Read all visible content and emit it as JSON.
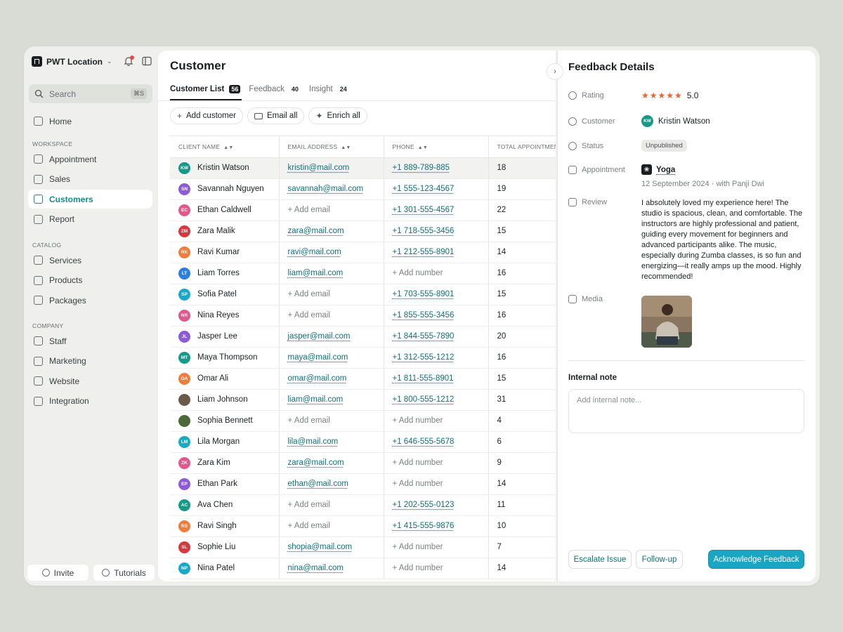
{
  "sidebar": {
    "location": "PWT Location",
    "search_placeholder": "Search",
    "search_shortcut": "⌘S",
    "home": "Home",
    "workspace_label": "WORKSPACE",
    "workspace": [
      "Appointment",
      "Sales",
      "Customers",
      "Report"
    ],
    "catalog_label": "CATALOG",
    "catalog": [
      "Services",
      "Products",
      "Packages"
    ],
    "company_label": "COMPANY",
    "company": [
      "Staff",
      "Marketing",
      "Website",
      "Integration"
    ],
    "invite": "Invite",
    "tutorials": "Tutorials"
  },
  "main": {
    "title": "Customer",
    "tabs": [
      {
        "label": "Customer List",
        "count": "56"
      },
      {
        "label": "Feedback",
        "count": "40"
      },
      {
        "label": "Insight",
        "count": "24"
      }
    ],
    "actions": {
      "add": "Add customer",
      "email": "Email all",
      "enrich": "Enrich all"
    },
    "columns": [
      "CLIENT NAME",
      "EMAIL ADDRESS",
      "PHONE",
      "TOTAL APPOINTMENTS"
    ],
    "rows": [
      {
        "initials": "KW",
        "color": "#159a8a",
        "name": "Kristin Watson",
        "email": "kristin@mail.com",
        "phone": "+1 889-789-885",
        "total": "18"
      },
      {
        "initials": "SN",
        "color": "#8e5bd6",
        "name": "Savannah Nguyen",
        "email": "savannah@mail.com",
        "phone": "+1 555-123-4567",
        "total": "19"
      },
      {
        "initials": "EC",
        "color": "#e2588a",
        "name": "Ethan Caldwell",
        "email": "+ Add email",
        "phone": "+1 301-555-4567",
        "total": "22"
      },
      {
        "initials": "ZM",
        "color": "#d9373f",
        "name": "Zara Malik",
        "email": "zara@mail.com",
        "phone": "+1 718-555-3456",
        "total": "15"
      },
      {
        "initials": "RK",
        "color": "#ef7d3c",
        "name": "Ravi Kumar",
        "email": "ravi@mail.com",
        "phone": "+1 212-555-8901",
        "total": "14"
      },
      {
        "initials": "LT",
        "color": "#2b7fe0",
        "name": "Liam Torres",
        "email": "liam@mail.com",
        "phone": "+ Add number",
        "total": "16"
      },
      {
        "initials": "SP",
        "color": "#17a9c7",
        "name": "Sofia Patel",
        "email": "+ Add email",
        "phone": "+1 703-555-8901",
        "total": "15"
      },
      {
        "initials": "NR",
        "color": "#e2588a",
        "name": "Nina Reyes",
        "email": "+ Add email",
        "phone": "+1 855-555-3456",
        "total": "16"
      },
      {
        "initials": "JL",
        "color": "#8e5bd6",
        "name": "Jasper Lee",
        "email": "jasper@mail.com",
        "phone": "+1 844-555-7890",
        "total": "20"
      },
      {
        "initials": "MT",
        "color": "#159a8a",
        "name": "Maya Thompson",
        "email": "maya@mail.com",
        "phone": "+1 312-555-1212",
        "total": "16"
      },
      {
        "initials": "OA",
        "color": "#ef7d3c",
        "name": "Omar Ali",
        "email": "omar@mail.com",
        "phone": "+1 811-555-8901",
        "total": "15"
      },
      {
        "initials": "",
        "color": "#6b5a4a",
        "name": "Liam Johnson",
        "email": "liam@mail.com",
        "phone": "+1 800-555-1212",
        "total": "31"
      },
      {
        "initials": "",
        "color": "#4a6a3a",
        "name": "Sophia Bennett",
        "email": "+ Add email",
        "phone": "+ Add number",
        "total": "4"
      },
      {
        "initials": "LM",
        "color": "#17a9c7",
        "name": "Lila Morgan",
        "email": "lila@mail.com",
        "phone": "+1 646-555-5678",
        "total": "6"
      },
      {
        "initials": "ZK",
        "color": "#e2588a",
        "name": "Zara Kim",
        "email": "zara@mail.com",
        "phone": "+ Add number",
        "total": "9"
      },
      {
        "initials": "EP",
        "color": "#8e5bd6",
        "name": "Ethan Park",
        "email": "ethan@mail.com",
        "phone": "+ Add number",
        "total": "14"
      },
      {
        "initials": "AC",
        "color": "#159a8a",
        "name": "Ava Chen",
        "email": "+ Add email",
        "phone": "+1 202-555-0123",
        "total": "11"
      },
      {
        "initials": "RS",
        "color": "#ef7d3c",
        "name": "Ravi Singh",
        "email": "+ Add email",
        "phone": "+1 415-555-9876",
        "total": "10"
      },
      {
        "initials": "SL",
        "color": "#d9373f",
        "name": "Sophie Liu",
        "email": "shopia@mail.com",
        "phone": "+ Add number",
        "total": "7"
      },
      {
        "initials": "NP",
        "color": "#17a9c7",
        "name": "Nina Patel",
        "email": "nina@mail.com",
        "phone": "+ Add number",
        "total": "14"
      }
    ]
  },
  "detail": {
    "title": "Feedback Details",
    "rating_label": "Rating",
    "rating_value": "5.0",
    "rating_stars": 5,
    "customer_label": "Customer",
    "customer_initials": "KW",
    "customer_name": "Kristin Watson",
    "status_label": "Status",
    "status_value": "Unpublished",
    "appointment_label": "Appointment",
    "appointment_name": "Yoga",
    "appointment_date": "12 September 2024",
    "appointment_with": "with Panji Dwi",
    "review_label": "Review",
    "review_text": "I absolutely loved my experience here! The studio is spacious, clean, and comfortable. The instructors are highly professional and patient, guiding every movement for beginners and advanced participants alike. The music, especially during Zumba classes, is so fun and energizing—it really amps up the mood. Highly recommended!",
    "media_label": "Media",
    "note_label": "Internal note",
    "note_placeholder": "Add internal note...",
    "buttons": {
      "escalate": "Escalate Issue",
      "follow": "Follow-up",
      "acknowledge": "Acknowledge Feedback"
    }
  },
  "colors": {
    "accent": "#1a8a8e",
    "primary_button": "#1aa6c2",
    "star": "#f0612d",
    "link": "#0f6f7a"
  }
}
